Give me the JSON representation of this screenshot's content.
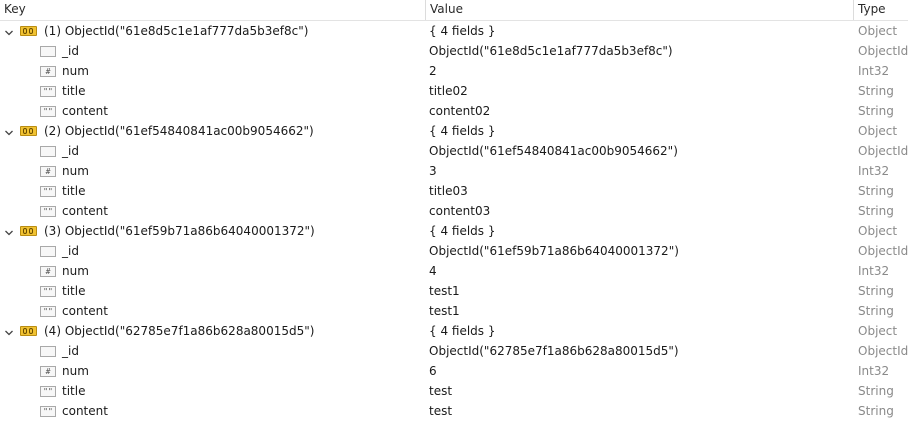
{
  "columns": {
    "key": "Key",
    "value": "Value",
    "type": "Type"
  },
  "documents": [
    {
      "key": "(1) ObjectId(\"61e8d5c1e1af777da5b3ef8c\")",
      "value": "{ 4 fields }",
      "type": "Object",
      "expanded": true,
      "fields": [
        {
          "key": "_id",
          "value": "ObjectId(\"61e8d5c1e1af777da5b3ef8c\")",
          "type": "ObjectId",
          "icon": "objectid-field-icon"
        },
        {
          "key": "num",
          "value": "2",
          "type": "Int32",
          "icon": "number-field-icon"
        },
        {
          "key": "title",
          "value": "title02",
          "type": "String",
          "icon": "string-field-icon"
        },
        {
          "key": "content",
          "value": "content02",
          "type": "String",
          "icon": "string-field-icon"
        }
      ]
    },
    {
      "key": "(2) ObjectId(\"61ef54840841ac00b9054662\")",
      "value": "{ 4 fields }",
      "type": "Object",
      "expanded": true,
      "fields": [
        {
          "key": "_id",
          "value": "ObjectId(\"61ef54840841ac00b9054662\")",
          "type": "ObjectId",
          "icon": "objectid-field-icon"
        },
        {
          "key": "num",
          "value": "3",
          "type": "Int32",
          "icon": "number-field-icon"
        },
        {
          "key": "title",
          "value": "title03",
          "type": "String",
          "icon": "string-field-icon"
        },
        {
          "key": "content",
          "value": "content03",
          "type": "String",
          "icon": "string-field-icon"
        }
      ]
    },
    {
      "key": "(3) ObjectId(\"61ef59b71a86b64040001372\")",
      "value": "{ 4 fields }",
      "type": "Object",
      "expanded": true,
      "fields": [
        {
          "key": "_id",
          "value": "ObjectId(\"61ef59b71a86b64040001372\")",
          "type": "ObjectId",
          "icon": "objectid-field-icon"
        },
        {
          "key": "num",
          "value": "4",
          "type": "Int32",
          "icon": "number-field-icon"
        },
        {
          "key": "title",
          "value": "test1",
          "type": "String",
          "icon": "string-field-icon"
        },
        {
          "key": "content",
          "value": "test1",
          "type": "String",
          "icon": "string-field-icon"
        }
      ]
    },
    {
      "key": "(4) ObjectId(\"62785e7f1a86b628a80015d5\")",
      "value": "{ 4 fields }",
      "type": "Object",
      "expanded": true,
      "fields": [
        {
          "key": "_id",
          "value": "ObjectId(\"62785e7f1a86b628a80015d5\")",
          "type": "ObjectId",
          "icon": "objectid-field-icon"
        },
        {
          "key": "num",
          "value": "6",
          "type": "Int32",
          "icon": "number-field-icon"
        },
        {
          "key": "title",
          "value": "test",
          "type": "String",
          "icon": "string-field-icon"
        },
        {
          "key": "content",
          "value": "test",
          "type": "String",
          "icon": "string-field-icon"
        }
      ]
    }
  ],
  "icon_glyphs": {
    "objectid-field-icon": "",
    "number-field-icon": "#",
    "string-field-icon": "\"\""
  },
  "colors": {
    "object_icon": "#f1c232",
    "type_text": "#8a8a8a",
    "header_border": "#e3e3e3"
  }
}
